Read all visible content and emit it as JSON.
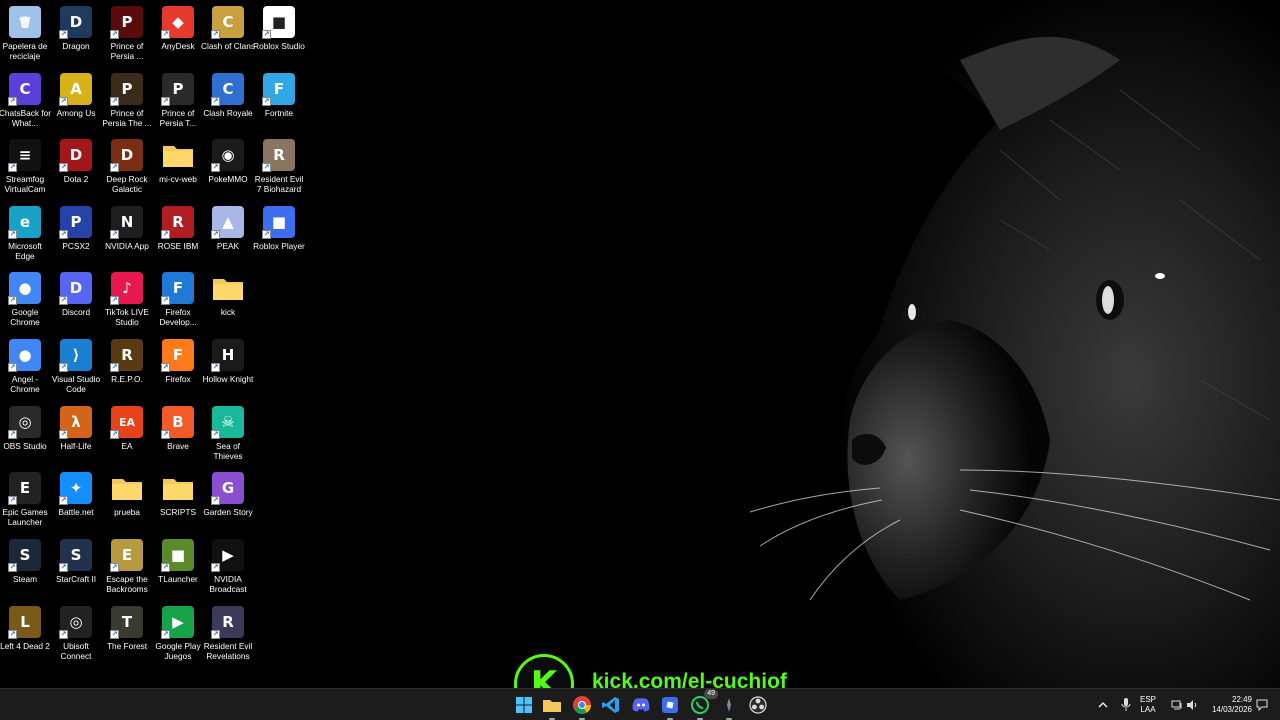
{
  "desktop": {
    "icons": [
      {
        "label": "Papelera de reciclaje",
        "icon": "recycle-bin-icon",
        "color": "#9fc2e8",
        "glyph": "🗑"
      },
      {
        "label": "Dragon",
        "icon": "dragon-icon",
        "color": "#1e3a5f",
        "glyph": "D"
      },
      {
        "label": "Prince of Persia ...",
        "icon": "prince-of-persia-icon",
        "color": "#5a0b0b",
        "glyph": "P"
      },
      {
        "label": "AnyDesk",
        "icon": "anydesk-icon",
        "color": "#e63a2f",
        "glyph": "◆"
      },
      {
        "label": "Clash of Clans",
        "icon": "clash-of-clans-icon",
        "color": "#c8a040",
        "glyph": "C"
      },
      {
        "label": "Roblox Studio",
        "icon": "roblox-studio-icon",
        "color": "#ffffff",
        "glyph": "■"
      },
      {
        "label": "ChatsBack for What...",
        "icon": "chatsback-icon",
        "color": "#5b3fd6",
        "glyph": "C"
      },
      {
        "label": "Among Us",
        "icon": "among-us-icon",
        "color": "#d8b21a",
        "glyph": "A"
      },
      {
        "label": "Prince of Persia The ...",
        "icon": "prince-of-persia-sands-icon",
        "color": "#3a2b1a",
        "glyph": "P"
      },
      {
        "label": "Prince of Persia T...",
        "icon": "prince-of-persia-t-icon",
        "color": "#2a2a2a",
        "glyph": "P"
      },
      {
        "label": "Clash Royale",
        "icon": "clash-royale-icon",
        "color": "#2f6fd0",
        "glyph": "C"
      },
      {
        "label": "Fortnite",
        "icon": "fortnite-icon",
        "color": "#31a7e6",
        "glyph": "F"
      },
      {
        "label": "Streamfog VirtualCam",
        "icon": "streamfog-icon",
        "color": "#111111",
        "glyph": "≡"
      },
      {
        "label": "Dota 2",
        "icon": "dota2-icon",
        "color": "#a3161a",
        "glyph": "D"
      },
      {
        "label": "Deep Rock Galactic",
        "icon": "deep-rock-galactic-icon",
        "color": "#7a2e14",
        "glyph": "D"
      },
      {
        "label": "mi-cv-web",
        "icon": "folder-icon",
        "color": "#f4c85a",
        "glyph": ""
      },
      {
        "label": "PokeMMO",
        "icon": "pokemmo-icon",
        "color": "#1a1a1a",
        "glyph": "◉"
      },
      {
        "label": "Resident Evil 7 Biohazard",
        "icon": "resident-evil-7-icon",
        "color": "#8a7560",
        "glyph": "R"
      },
      {
        "label": "Microsoft Edge",
        "icon": "edge-icon",
        "color": "#1aa1c9",
        "glyph": "e"
      },
      {
        "label": "PCSX2",
        "icon": "pcsx2-icon",
        "color": "#2442a8",
        "glyph": "P"
      },
      {
        "label": "NVIDIA App",
        "icon": "nvidia-app-icon",
        "color": "#1e1e1e",
        "glyph": "N"
      },
      {
        "label": "ROSE IBM",
        "icon": "rose-ibm-icon",
        "color": "#b01e24",
        "glyph": "R"
      },
      {
        "label": "PEAK",
        "icon": "peak-icon",
        "color": "#a8b7e8",
        "glyph": "▲"
      },
      {
        "label": "Roblox Player",
        "icon": "roblox-player-icon",
        "color": "#3c6ef0",
        "glyph": "■"
      },
      {
        "label": "Google Chrome",
        "icon": "chrome-icon",
        "color": "#4285f4",
        "glyph": "●"
      },
      {
        "label": "Discord",
        "icon": "discord-icon",
        "color": "#5865f2",
        "glyph": "D"
      },
      {
        "label": "TikTok LIVE Studio",
        "icon": "tiktok-live-icon",
        "color": "#e5194d",
        "glyph": "♪"
      },
      {
        "label": "Firefox Develop...",
        "icon": "firefox-developer-icon",
        "color": "#1f7ad6",
        "glyph": "F"
      },
      {
        "label": "kick",
        "icon": "folder-icon",
        "color": "#f4c85a",
        "glyph": ""
      },
      {
        "label": "",
        "icon": "empty-slot",
        "color": "",
        "glyph": ""
      },
      {
        "label": "Angel - Chrome",
        "icon": "angel-chrome-icon",
        "color": "#4285f4",
        "glyph": "●"
      },
      {
        "label": "Visual Studio Code",
        "icon": "vscode-icon",
        "color": "#1a7fd0",
        "glyph": "⟩"
      },
      {
        "label": "R.E.P.O.",
        "icon": "repo-icon",
        "color": "#5a3a10",
        "glyph": "R"
      },
      {
        "label": "Firefox",
        "icon": "firefox-icon",
        "color": "#ff7a1a",
        "glyph": "F"
      },
      {
        "label": "Hollow Knight",
        "icon": "hollow-knight-icon",
        "color": "#1a1a1a",
        "glyph": "H"
      },
      {
        "label": "",
        "icon": "empty-slot",
        "color": "",
        "glyph": ""
      },
      {
        "label": "OBS Studio",
        "icon": "obs-icon",
        "color": "#2a2a2a",
        "glyph": "◎"
      },
      {
        "label": "Half-Life",
        "icon": "half-life-icon",
        "color": "#d6631a",
        "glyph": "λ"
      },
      {
        "label": "EA",
        "icon": "ea-icon",
        "color": "#e8421a",
        "glyph": "EA"
      },
      {
        "label": "Brave",
        "icon": "brave-icon",
        "color": "#f05a24",
        "glyph": "B"
      },
      {
        "label": "Sea of Thieves",
        "icon": "sea-of-thieves-icon",
        "color": "#1ab89a",
        "glyph": "☠"
      },
      {
        "label": "",
        "icon": "empty-slot",
        "color": "",
        "glyph": ""
      },
      {
        "label": "Epic Games Launcher",
        "icon": "epic-games-icon",
        "color": "#222222",
        "glyph": "E"
      },
      {
        "label": "Battle.net",
        "icon": "battlenet-icon",
        "color": "#148eff",
        "glyph": "✦"
      },
      {
        "label": "prueba",
        "icon": "folder-icon",
        "color": "#f4c85a",
        "glyph": ""
      },
      {
        "label": "SCRIPTS",
        "icon": "folder-icon",
        "color": "#f4c85a",
        "glyph": ""
      },
      {
        "label": "Garden Story",
        "icon": "garden-story-icon",
        "color": "#8a4fd0",
        "glyph": "G"
      },
      {
        "label": "",
        "icon": "empty-slot",
        "color": "",
        "glyph": ""
      },
      {
        "label": "Steam",
        "icon": "steam-icon",
        "color": "#1b2838",
        "glyph": "S"
      },
      {
        "label": "StarCraft II",
        "icon": "starcraft2-icon",
        "color": "#22324a",
        "glyph": "S"
      },
      {
        "label": "Escape the Backrooms",
        "icon": "escape-backrooms-icon",
        "color": "#b69a40",
        "glyph": "E"
      },
      {
        "label": "TLauncher",
        "icon": "tlauncher-icon",
        "color": "#5a8a2a",
        "glyph": "■"
      },
      {
        "label": "NVIDIA Broadcast",
        "icon": "nvidia-broadcast-icon",
        "color": "#111111",
        "glyph": "▶"
      },
      {
        "label": "",
        "icon": "empty-slot",
        "color": "",
        "glyph": ""
      },
      {
        "label": "Left 4 Dead 2",
        "icon": "left4dead2-icon",
        "color": "#7a5a1a",
        "glyph": "L"
      },
      {
        "label": "Ubisoft Connect",
        "icon": "ubisoft-icon",
        "color": "#222222",
        "glyph": "◎"
      },
      {
        "label": "The Forest",
        "icon": "the-forest-icon",
        "color": "#3a3a30",
        "glyph": "T"
      },
      {
        "label": "Google Play Juegos",
        "icon": "google-play-games-icon",
        "color": "#17a34a",
        "glyph": "▶"
      },
      {
        "label": "Resident Evil Revelations",
        "icon": "resident-evil-revelations-icon",
        "color": "#3a3a5a",
        "glyph": "R"
      },
      {
        "label": "",
        "icon": "empty-slot",
        "color": "",
        "glyph": ""
      }
    ]
  },
  "overlay": {
    "kick_letter": "K",
    "kick_url": "kick.com/el-cuchiof",
    "kick_color": "#53fc18"
  },
  "taskbar": {
    "apps": [
      {
        "name": "start-button",
        "icon": "windows-start-icon"
      },
      {
        "name": "taskbar-file-explorer",
        "icon": "folder-icon"
      },
      {
        "name": "taskbar-chrome",
        "icon": "chrome-icon"
      },
      {
        "name": "taskbar-vscode",
        "icon": "vscode-icon"
      },
      {
        "name": "taskbar-discord",
        "icon": "discord-icon"
      },
      {
        "name": "taskbar-roblox",
        "icon": "roblox-icon"
      },
      {
        "name": "taskbar-whatsapp",
        "icon": "whatsapp-icon"
      },
      {
        "name": "taskbar-streamfog",
        "icon": "app-icon"
      },
      {
        "name": "taskbar-obs",
        "icon": "obs-icon"
      }
    ],
    "whatsapp_badge": "49",
    "language_line1": "ESP",
    "language_line2": "LAA",
    "time": "22:49",
    "date": "14/03/2026"
  }
}
